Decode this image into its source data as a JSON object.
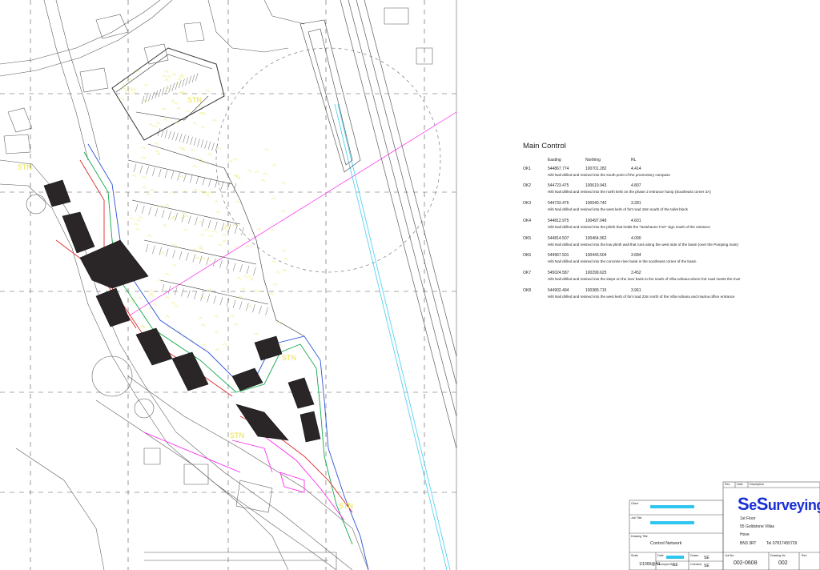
{
  "main_control": {
    "title": "Main Control",
    "headers": {
      "easting": "Easting",
      "northing": "Northing",
      "rl": "RL"
    },
    "points": [
      {
        "id": "OK1",
        "easting": "544867.774",
        "northing": "100701.282",
        "rl": "4.414",
        "desc": "Hilti Nail drilled and resined into the south point of the promontory compass"
      },
      {
        "id": "OK2",
        "easting": "544723.475",
        "northing": "100619.943",
        "rl": "4.807",
        "desc": "Hilti Nail drilled and resined into the north kerb on the phase 2 entrance hump (Southeast corner 2A)"
      },
      {
        "id": "OK3",
        "easting": "544733.475",
        "northing": "100540.742",
        "rl": "3.281",
        "desc": "Hilti Nail drilled and resined into the west kerb of fort road 16m south of the toilet block"
      },
      {
        "id": "OK4",
        "easting": "544812.975",
        "northing": "100497.049",
        "rl": "4.601",
        "desc": "Hilti Nail drilled and resined into the plinth that holds the \"Newhaven Fort\" sign south of the entrance"
      },
      {
        "id": "OK5",
        "easting": "544814.507",
        "northing": "100464.962",
        "rl": "4.090",
        "desc": "Hilti Nail drilled and resined into the low plinth wall that runs along the west side of the basin (over the Pumping main)"
      },
      {
        "id": "OK6",
        "easting": "544967.501",
        "northing": "100443.504",
        "rl": "3.684",
        "desc": "Hilti Nail drilled and resined into the concrete river bank in the southeast corner of the basin"
      },
      {
        "id": "OK7",
        "easting": "545024.587",
        "northing": "100299.625",
        "rl": "3.452",
        "desc": "Hilti Nail drilled and resined into the steps on the river bank to the south of Villa Adriana where fort road meets the river"
      },
      {
        "id": "OK8",
        "easting": "544902.494",
        "northing": "100389.715",
        "rl": "3.961",
        "desc": "Hilti Nail drilled and resined into the west kerb of fort road 23m north of the Villa Adriana and marina office entrance"
      }
    ]
  },
  "map_labels": {
    "stn_a": "STN",
    "stn_b": "STN",
    "stn_c": "STN",
    "stn_d": "STN",
    "stn_e": "STN"
  },
  "title_block": {
    "rev_label": "Rev",
    "date_label": "Date",
    "description_label": "Description",
    "client_label": "Client",
    "job_title_label": "Job Title",
    "drawing_title_label": "Drawing Title",
    "drawing_title": "Control Network",
    "scale_label": "Scale",
    "scale_value": "1/1000@A1",
    "date2_label": "Date",
    "surveyed_by_label": "Surveyed By",
    "surveyed_by_value": "SE",
    "drawn_label": "Drawn",
    "drawn_value": "SE",
    "checked_label": "Checked",
    "checked_value": "SE",
    "job_no_label": "Job No",
    "job_no_value": "002-0608",
    "drawing_no_label": "Drawing No",
    "drawing_no_value": "002",
    "rev2_label": "Rev",
    "logo_s1": "S",
    "logo_e": "e",
    "logo_s2": "S",
    "logo_rest": "urveying",
    "address_1": "1st Floor",
    "address_2": "55 Goldstone Villas",
    "address_3": "Hove",
    "address_4": "BN3 3RT",
    "tel": "Tel  07817455729"
  },
  "colors": {
    "building": "#2a2628",
    "magenta": "#ff2cf0",
    "cyan": "#2ec6ee",
    "yellow": "#e9e23c",
    "logo_blue": "#1a2fd6"
  }
}
